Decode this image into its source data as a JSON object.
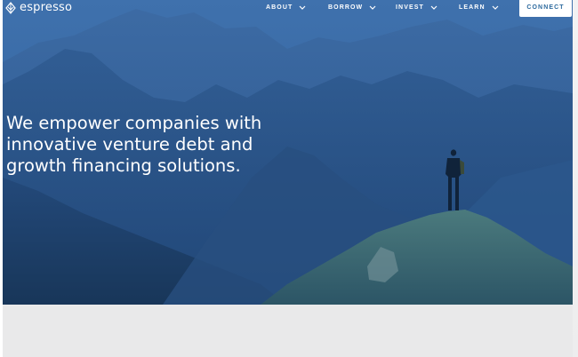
{
  "brand": {
    "name": "espresso",
    "logo_icon": "leaf-icon"
  },
  "nav": {
    "items": [
      {
        "label": "ABOUT",
        "icon": "chevron-down-icon"
      },
      {
        "label": "BORROW",
        "icon": "chevron-down-icon"
      },
      {
        "label": "INVEST",
        "icon": "chevron-down-icon"
      },
      {
        "label": "LEARN",
        "icon": "chevron-down-icon"
      }
    ],
    "connect_label": "CONNECT"
  },
  "hero": {
    "headline": "We empower companies with innovative venture debt and growth financing solutions."
  },
  "colors": {
    "overlay_blue": "#244f86",
    "connect_text": "#2d6a9e",
    "footer_grey": "#e9e9ea"
  }
}
